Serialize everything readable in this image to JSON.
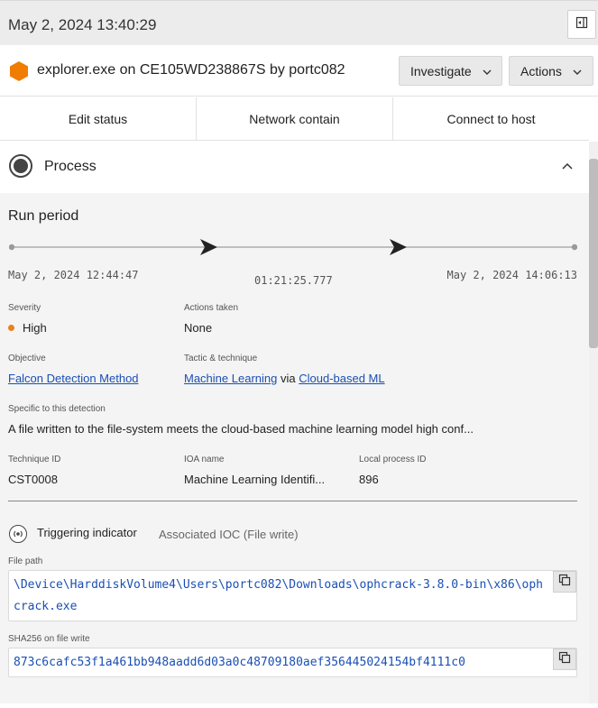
{
  "topbar": {
    "timestamp": "May 2, 2024 13:40:29"
  },
  "header": {
    "title": "explorer.exe on CE105WD238867S by portc082",
    "investigate_label": "Investigate",
    "actions_label": "Actions",
    "severity_color": "#f07c00"
  },
  "quick_actions": {
    "edit_status": "Edit status",
    "network_contain": "Network contain",
    "connect_to_host": "Connect to host"
  },
  "section": {
    "title": "Process"
  },
  "run_period": {
    "title": "Run period",
    "start": "May 2, 2024 12:44:47",
    "duration": "01:21:25.777",
    "end": "May 2, 2024 14:06:13"
  },
  "details": {
    "severity_label": "Severity",
    "severity_value": "High",
    "severity_color": "#e8821b",
    "actions_taken_label": "Actions taken",
    "actions_taken_value": "None",
    "objective_label": "Objective",
    "objective_value": "Falcon Detection Method",
    "tactic_label": "Tactic & technique",
    "tactic_value": "Machine Learning",
    "tactic_via": "via",
    "technique_value": "Cloud-based ML",
    "specific_label": "Specific to this detection",
    "specific_value": "A file written to the file-system meets the cloud-based machine learning model high conf...",
    "technique_id_label": "Technique ID",
    "technique_id_value": "CST0008",
    "ioa_name_label": "IOA name",
    "ioa_name_value": "Machine Learning Identifi...",
    "local_pid_label": "Local process ID",
    "local_pid_value": "896"
  },
  "triggering": {
    "title": "Triggering indicator",
    "subtitle": "Associated IOC (File write)",
    "file_path_label": "File path",
    "file_path_value": "\\Device\\HarddiskVolume4\\Users\\portc082\\Downloads\\ophcrack-3.8.0-bin\\x86\\ophcrack.exe",
    "sha_label": "SHA256 on file write",
    "sha_value": "873c6cafc53f1a461bb948aadd6d03a0c48709180aef356445024154bf4111c0"
  }
}
